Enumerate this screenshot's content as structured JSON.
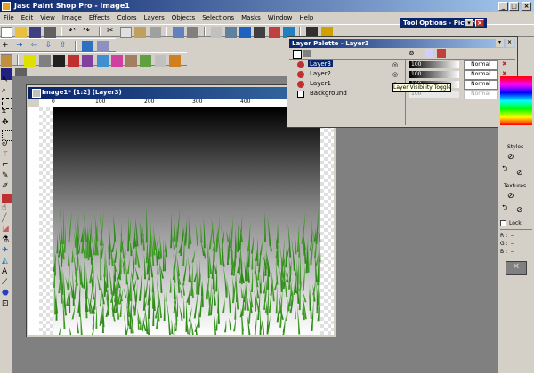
{
  "app": {
    "title": "Jasc Paint Shop Pro - Image1"
  },
  "menu": [
    "File",
    "Edit",
    "View",
    "Image",
    "Effects",
    "Colors",
    "Layers",
    "Objects",
    "Selections",
    "Masks",
    "Window",
    "Help"
  ],
  "tool_options": {
    "title": "Tool Options - Picture"
  },
  "image_window": {
    "title": "Image1* [1:2] (Layer3)",
    "ruler_labels": [
      "0",
      "100",
      "200",
      "300",
      "400",
      "500"
    ]
  },
  "layer_palette": {
    "title": "Layer Palette - Layer3",
    "layers": [
      {
        "name": "Layer3",
        "opacity": "100",
        "blend": "Normal",
        "selected": true
      },
      {
        "name": "Layer2",
        "opacity": "100",
        "blend": "Normal",
        "selected": false
      },
      {
        "name": "Layer1",
        "opacity": "100",
        "blend": "Normal",
        "selected": false
      },
      {
        "name": "Background",
        "opacity": "100",
        "blend": "Normal",
        "selected": false
      }
    ],
    "tooltip": "Layer Visibility Toggle"
  },
  "right_panel": {
    "styles": "Styles",
    "textures": "Textures",
    "lock": "Lock",
    "r": "R :",
    "g": "G :",
    "b": "B :",
    "dash": "--"
  },
  "colors": {
    "title_blue": "#0a246a",
    "face": "#d4d0c8",
    "workspace": "#808080",
    "grass": "#2e8a1a"
  }
}
